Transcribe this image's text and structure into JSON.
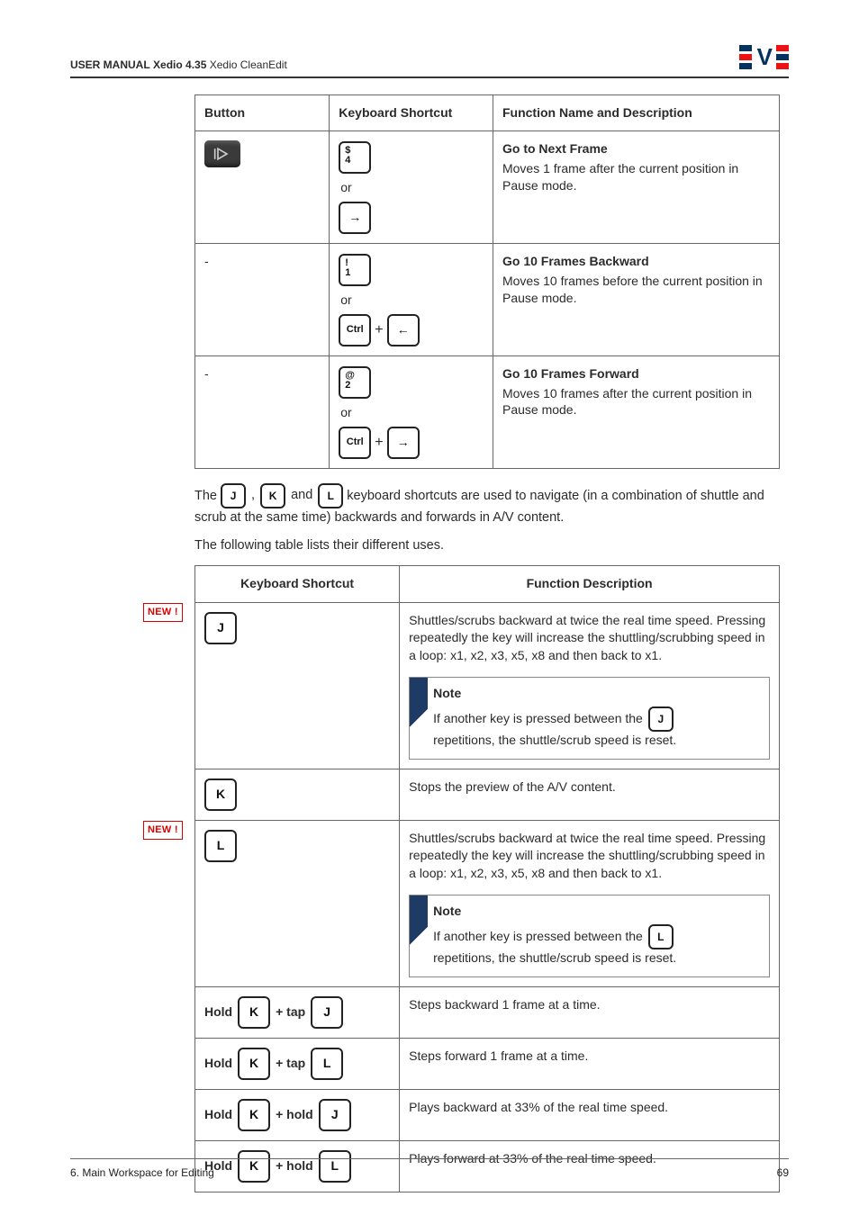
{
  "header": {
    "manual_prefix": "USER MANUAL",
    "manual_title": "Xedio 4.35",
    "manual_sub": "Xedio CleanEdit",
    "logo_v": "V"
  },
  "tableA": {
    "head": {
      "c1": "Button",
      "c2": "Keyboard Shortcut",
      "c3": "Function Name and Description"
    },
    "rows": [
      {
        "button": "play-next",
        "k1_top": "$",
        "k1_bot": "4",
        "or": "or",
        "k2": "→",
        "fn": "Go to Next Frame",
        "desc": "Moves 1 frame after the current position in Pause mode."
      },
      {
        "button": "-",
        "k1_top": "!",
        "k1_bot": "1",
        "or": "or",
        "ctrl": "Ctrl",
        "plus": "+",
        "k2": "←",
        "fn": "Go 10 Frames Backward",
        "desc": "Moves 10 frames before the current position in Pause mode."
      },
      {
        "button": "-",
        "k1_top": "@",
        "k1_bot": "2",
        "or": "or",
        "ctrl": "Ctrl",
        "plus": "+",
        "k2": "→",
        "fn": "Go 10 Frames Forward",
        "desc": "Moves 10 frames after the current position in Pause mode."
      }
    ]
  },
  "midpara": {
    "pre": "The",
    "j": "J",
    "comma": ",",
    "k": "K",
    "and": "and",
    "l": "L",
    "post": "keyboard shortcuts are used to navigate (in a combination of shuttle and scrub at the same time) backwards and forwards in A/V content.",
    "after": "The following table lists their different uses."
  },
  "new_label": "NEW !",
  "tableB": {
    "head": {
      "c1": "Keyboard Shortcut",
      "c2": "Function Description"
    },
    "rows": [
      {
        "key": "J",
        "desc": "Shuttles/scrubs backward at twice the real time speed. Pressing repeatedly the key will increase the shuttling/scrubbing speed in a loop: x1, x2, x3, x5, x8 and then back to x1.",
        "note_title": "Note",
        "note_text": "If another key is pressed between the",
        "note_key": "J",
        "note_after": "repetitions, the shuttle/scrub speed is reset."
      },
      {
        "key": "K",
        "desc": "Stops the preview of the A/V content."
      },
      {
        "key": "L",
        "desc": "Shuttles/scrubs backward at twice the real time speed. Pressing repeatedly the key will increase the shuttling/scrubbing speed in a loop: x1, x2, x3, x5, x8 and then back to x1.",
        "note_title": "Note",
        "note_text": "If another key is pressed between the",
        "note_key": "L",
        "note_after": "repetitions, the shuttle/scrub speed is reset."
      },
      {
        "hold": "Hold",
        "k1": "K",
        "verb": "+ tap",
        "k2": "J",
        "desc": "Steps backward 1 frame at a time."
      },
      {
        "hold": "Hold",
        "k1": "K",
        "verb": "+ tap",
        "k2": "L",
        "desc": "Steps forward 1 frame at a time."
      },
      {
        "hold": "Hold",
        "k1": "K",
        "verb": "+ hold",
        "k2": "J",
        "desc": "Plays backward at 33% of the real time speed."
      },
      {
        "hold": "Hold",
        "k1": "K",
        "verb": "+ hold",
        "k2": "L",
        "desc": "Plays forward at 33% of the real time speed."
      }
    ]
  },
  "footer": {
    "left": "6. Main Workspace for Editing",
    "right": "69"
  }
}
